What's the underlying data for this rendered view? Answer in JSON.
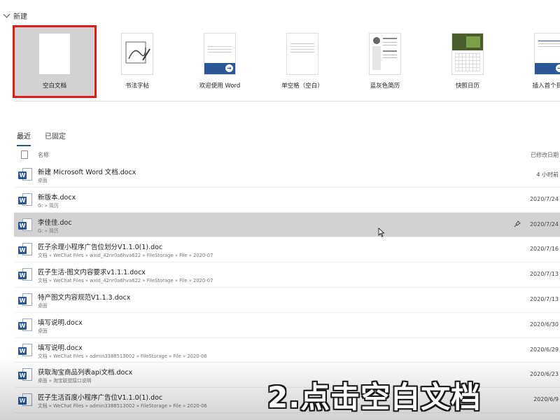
{
  "new_section": {
    "title": "新建",
    "templates": [
      {
        "name": "空白文档",
        "thumb": "blank"
      },
      {
        "name": "书法字帖",
        "thumb": "calligraphy"
      },
      {
        "name": "欢迎使用 Word",
        "thumb": "welcome"
      },
      {
        "name": "单空格（空白）",
        "thumb": "single"
      },
      {
        "name": "蓝灰色简历",
        "thumb": "resume"
      },
      {
        "name": "快照日历",
        "thumb": "calendar"
      },
      {
        "name": "插入首个目录",
        "thumb": "toc"
      }
    ]
  },
  "tabs": [
    {
      "label": "最近",
      "active": true
    },
    {
      "label": "已固定",
      "active": false
    }
  ],
  "list": {
    "header_name": "名称",
    "header_date": "已修改日期",
    "rows": [
      {
        "name": "新建 Microsoft Word 文档.docx",
        "path": "桌面",
        "date": "4 小时前"
      },
      {
        "name": "新版本.docx",
        "path": "G: » 简历",
        "date": "2020/7/24"
      },
      {
        "name": "李佳佳.doc",
        "path": "G: » 简历",
        "date": "2020/7/24"
      },
      {
        "name": "匠子余理小程序广告位划分V1.1.0(1).doc",
        "path": "文档 » WeChat Files » wxid_42nr0a6hva622 » FileStorage » File » 2020-07",
        "date": "2020/7/16"
      },
      {
        "name": "匠子生活-图文内容要求v1.1.1.docx",
        "path": "文档 » WeChat Files » wxid_42nr0a6hva622 » FileStorage » File » 2020-07",
        "date": "2020/7/13"
      },
      {
        "name": "特产图文内容规范V1.1.3.docx",
        "path": "桌面",
        "date": "2020/7/13"
      },
      {
        "name": "填写说明.docx",
        "path": "桌面",
        "date": "2020/6/30"
      },
      {
        "name": "填写说明.docx",
        "path": "文档 » WeChat Files » admin3388513002 » FileStorage » File » 2020-06",
        "date": "2020/6/29"
      },
      {
        "name": "获取淘宝商品列表api文档.docx",
        "path": "桌面 » 淘宝联盟接口说明",
        "date": "2020/6/23"
      },
      {
        "name": "匠子生活百度小程序广告位V1.1.0(1).doc",
        "path": "文档 » WeChat Files » admin3388513002 » FileStorage » File » 2020-06",
        "date": "2020/6/9"
      }
    ]
  },
  "caption": "2.点击空白文档",
  "colors": {
    "accent": "#2b5797",
    "highlight": "#e01b1b",
    "hover": "#d2d2d2"
  }
}
